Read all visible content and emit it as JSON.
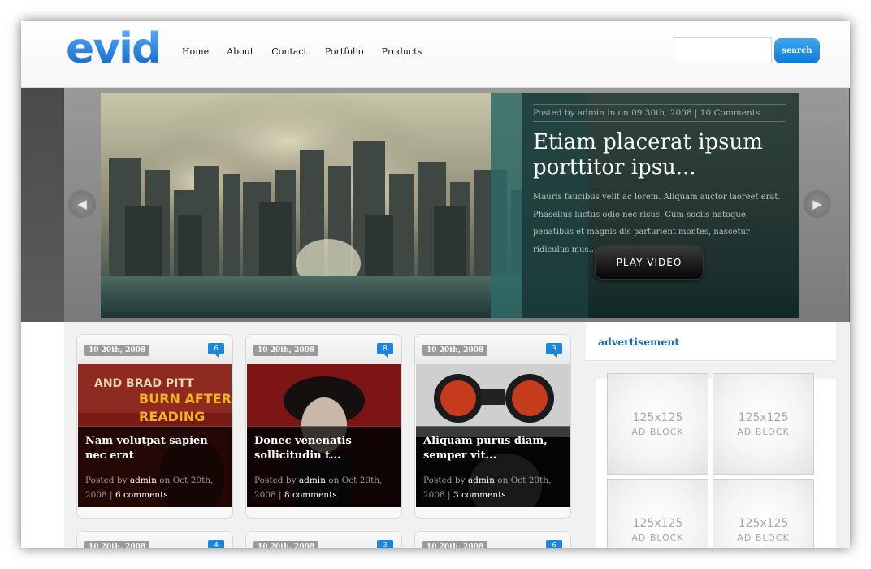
{
  "header": {
    "logo": "evid",
    "nav": [
      "Home",
      "About",
      "Contact",
      "Portfolio",
      "Products"
    ],
    "search_placeholder": "",
    "search_button": "search"
  },
  "slider": {
    "meta": "Posted by admin in on 09 30th, 2008 | 10 Comments",
    "title": "Etiam placerat ipsum porttitor ipsu...",
    "text": "Mauris faucibus velit ac lorem. Aliquam auctor laoreet erat. Phasellus luctus odio nec risus. Cum sociis natoque penatibus et magnis dis parturient montes, nascetur ridiculus mus....",
    "play_button": "PLAY VIDEO",
    "prev_icon": "arrow-left-icon",
    "next_icon": "arrow-right-icon"
  },
  "posts": [
    {
      "date": "10 20th, 2008",
      "comments_badge": "6",
      "title": "Nam volutpat sapien nec erat",
      "posted_by": "Posted by",
      "author": "admin",
      "on": "on Oct 20th, 2008 |",
      "comments": "6 comments",
      "image_text": [
        "AND BRAD PITT",
        "BURN AFTER",
        "READING"
      ]
    },
    {
      "date": "10 20th, 2008",
      "comments_badge": "8",
      "title": "Donec venenatis sollicitudin t...",
      "posted_by": "Posted by",
      "author": "admin",
      "on": "on Oct 20th, 2008 |",
      "comments": "8 comments"
    },
    {
      "date": "10 20th, 2008",
      "comments_badge": "3",
      "title": "Aliquam purus diam, semper vit...",
      "posted_by": "Posted by",
      "author": "admin",
      "on": "on Oct 20th, 2008 |",
      "comments": "3 comments"
    }
  ],
  "posts_row2": [
    {
      "date": "10 20th, 2008",
      "comments_badge": "4"
    },
    {
      "date": "10 20th, 2008",
      "comments_badge": "3"
    },
    {
      "date": "10 20th, 2008",
      "comments_badge": "6"
    }
  ],
  "sidebar": {
    "heading": "advertisement",
    "ads": [
      {
        "size": "125x125",
        "label": "AD BLOCK"
      },
      {
        "size": "125x125",
        "label": "AD BLOCK"
      },
      {
        "size": "125x125",
        "label": "AD BLOCK"
      },
      {
        "size": "125x125",
        "label": "AD BLOCK"
      }
    ]
  },
  "colors": {
    "accent": "#1a76d0",
    "search_button": "#1e86d8",
    "comment_badge": "#1e86d8"
  }
}
